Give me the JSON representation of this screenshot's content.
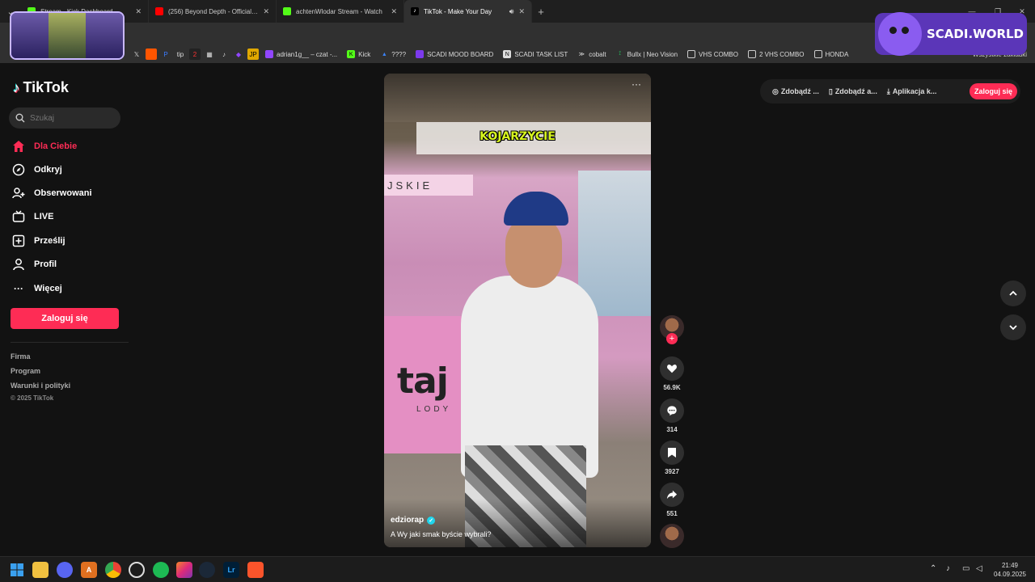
{
  "browser": {
    "tabs": [
      {
        "title": "Stream - Kick Dashboard",
        "color": "#53fc18",
        "active": false
      },
      {
        "title": "(256) Beyond Depth - Official M",
        "color": "#ff0000",
        "active": false
      },
      {
        "title": "achtenWlodar Stream - Watch",
        "color": "#53fc18",
        "active": false
      },
      {
        "title": "TikTok - Make Your Day",
        "color": "#000000",
        "active": true
      }
    ],
    "bookmarks": [
      {
        "label": "adrian1g__ – czat -...",
        "color": "#9146ff"
      },
      {
        "label": "Kick",
        "color": "#53fc18"
      },
      {
        "label": "????",
        "color": "#3b82f6"
      },
      {
        "label": "SCADI MOOD BOARD",
        "color": "#7c3aed"
      },
      {
        "label": "SCADI TASK LIST",
        "color": "#dddddd"
      },
      {
        "label": "cobalt",
        "color": "#dddddd"
      },
      {
        "label": "Bullx | Neo Vision",
        "color": "#22c55e"
      },
      {
        "label": "VHS COMBO",
        "color": "folder"
      },
      {
        "label": "2 VHS COMBO",
        "color": "folder"
      },
      {
        "label": "HONDA",
        "color": "folder"
      }
    ],
    "bookmarks_right": "Wszystkie zakładki"
  },
  "overlay": {
    "scadi": "SCADI.WORLD"
  },
  "tiktok": {
    "logo": "TikTok",
    "search_placeholder": "Szukaj",
    "nav": [
      {
        "label": "Dla Ciebie",
        "icon": "home-icon",
        "active": true
      },
      {
        "label": "Odkryj",
        "icon": "compass-icon",
        "active": false
      },
      {
        "label": "Obserwowani",
        "icon": "following-icon",
        "active": false
      },
      {
        "label": "LIVE",
        "icon": "live-icon",
        "active": false
      },
      {
        "label": "Prześlij",
        "icon": "upload-icon",
        "active": false
      },
      {
        "label": "Profil",
        "icon": "profile-icon",
        "active": false
      },
      {
        "label": "Więcej",
        "icon": "more-icon",
        "active": false
      }
    ],
    "login_button": "Zaloguj się",
    "footer_links": [
      "Firma",
      "Program",
      "Warunki i polityki"
    ],
    "copyright": "© 2025 TikTok",
    "top_actions": [
      "Zdobądź ...",
      "Zdobądź a...",
      "Aplikacja k..."
    ],
    "top_login": "Zaloguj się",
    "video": {
      "caption_overlay": "KOJARZYCIE",
      "sign_text": "JSKIE",
      "brand": "taj",
      "brand_sub": "LODY",
      "author": "edziorap",
      "description": "A Wy jaki smak byście wybrali?"
    },
    "actions": {
      "likes": "56.9K",
      "comments": "314",
      "saves": "3927",
      "shares": "551"
    },
    "accent": "#fe2c55"
  },
  "taskbar": {
    "time": "21:49",
    "date": "04.09.2025"
  }
}
